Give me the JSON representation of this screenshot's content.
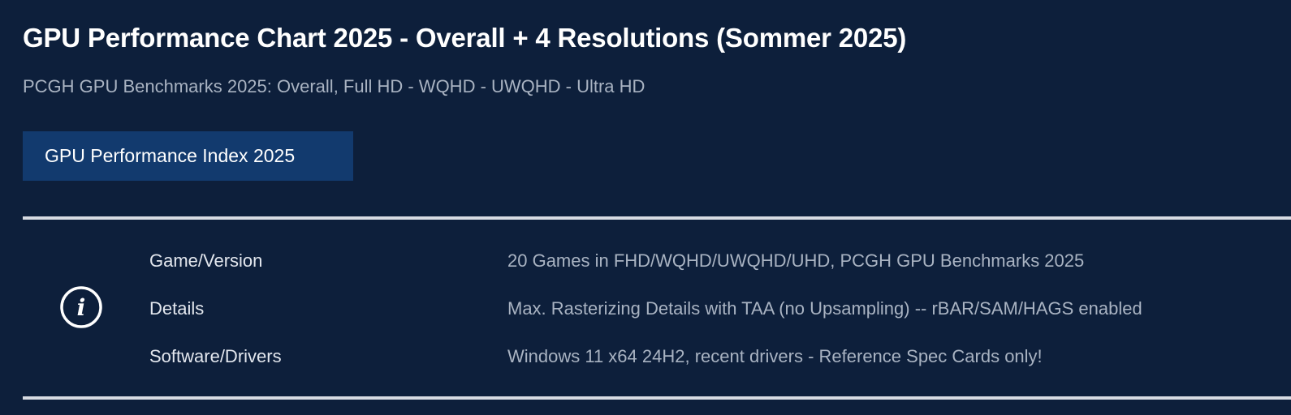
{
  "header": {
    "title": "GPU Performance Chart 2025 - Overall + 4 Resolutions (Sommer 2025)",
    "subtitle": "PCGH GPU Benchmarks 2025: Overall, Full HD - WQHD - UWQHD - Ultra HD"
  },
  "buttons": {
    "index_label": "GPU Performance Index 2025"
  },
  "info": {
    "icon": "info-icon",
    "rows": [
      {
        "label": "Game/Version",
        "value": "20 Games in FHD/WQHD/UWQHD/UHD, PCGH GPU Benchmarks 2025"
      },
      {
        "label": "Details",
        "value": "Max. Rasterizing Details with TAA (no Upsampling) -- rBAR/SAM/HAGS enabled"
      },
      {
        "label": "Software/Drivers",
        "value": "Windows 11 x64 24H2, recent drivers - Reference Spec Cards only!"
      }
    ]
  },
  "colors": {
    "background": "#0d1f3b",
    "button_background": "#123a6e",
    "title_text": "#ffffff",
    "muted_text": "#a9b3c2",
    "divider": "#d7dbe2"
  }
}
